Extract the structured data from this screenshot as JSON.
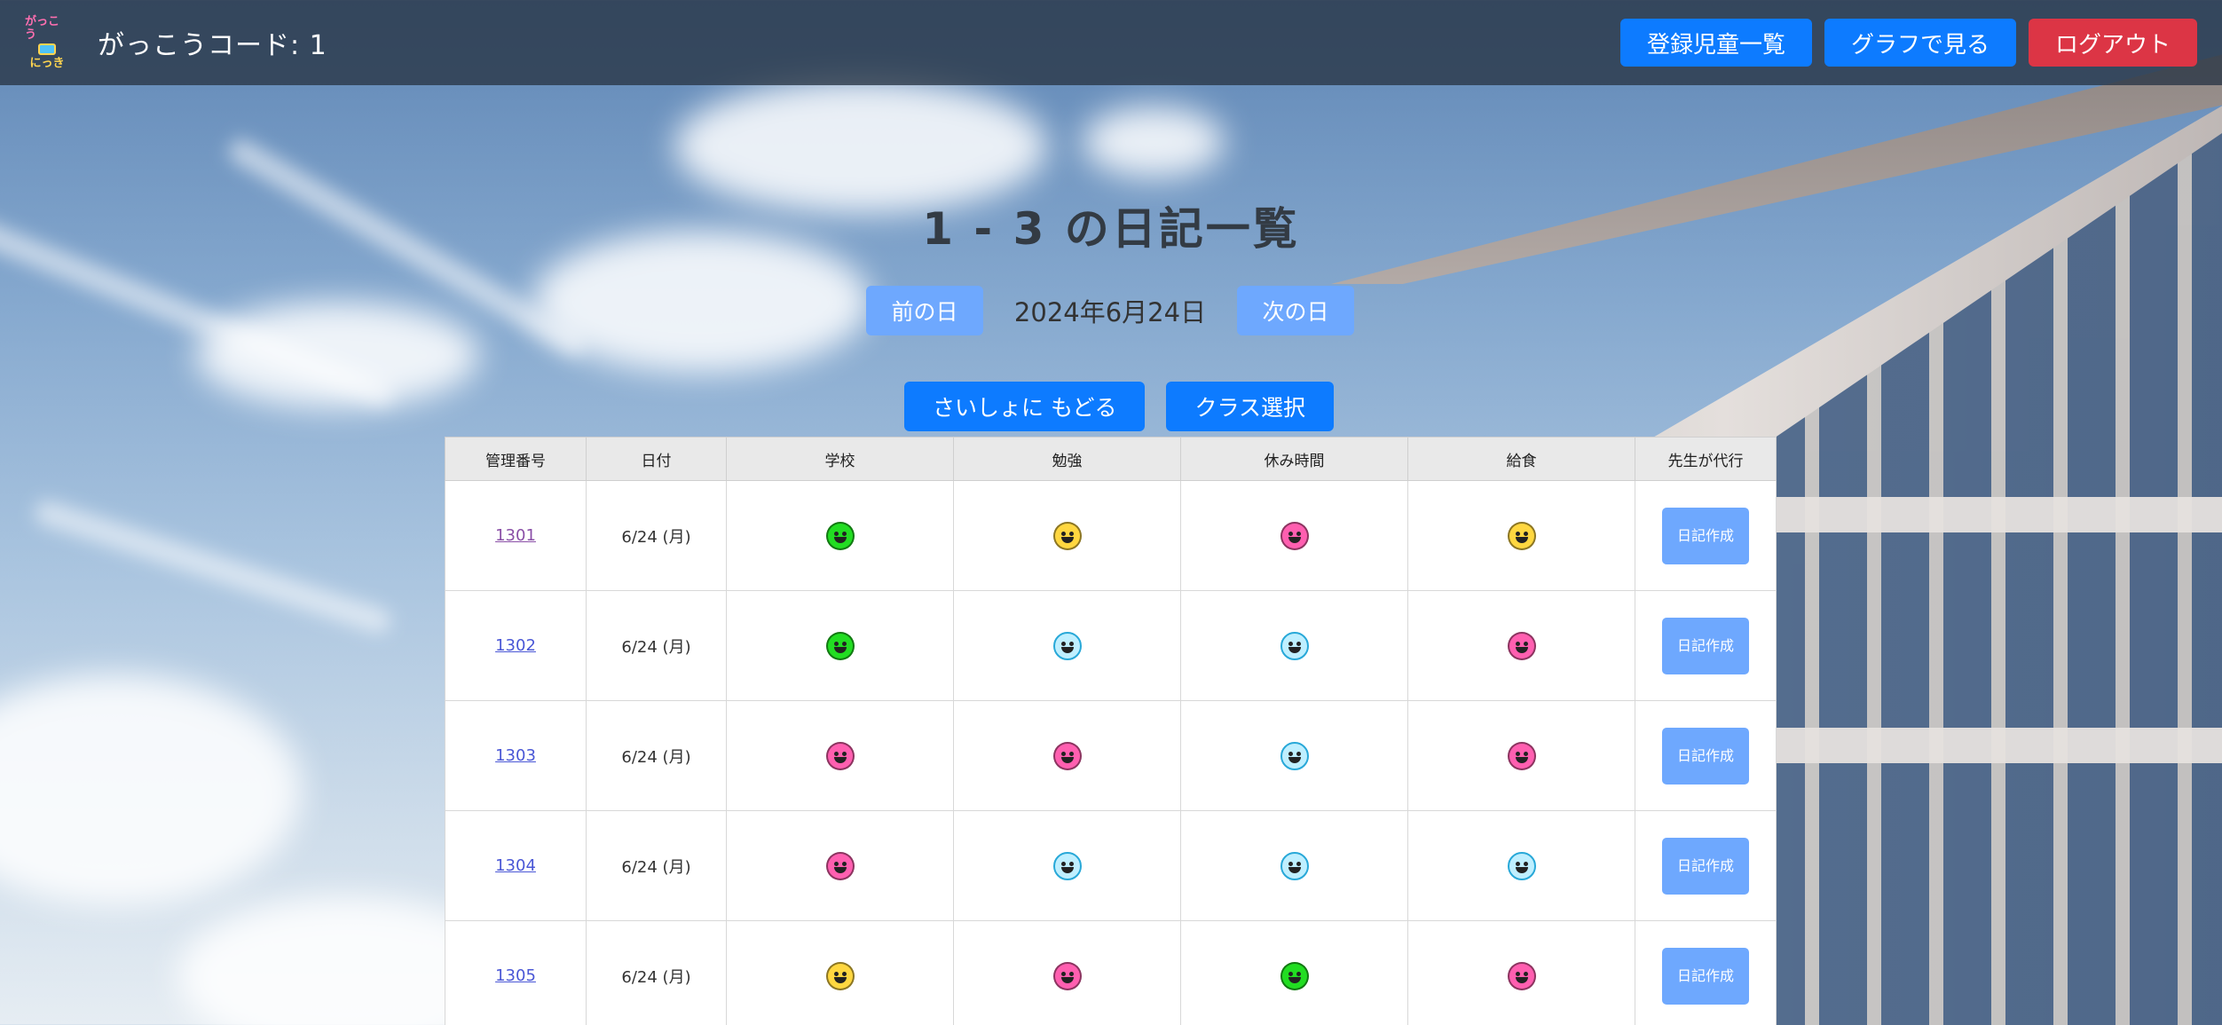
{
  "header": {
    "logo_text_top": "がっこう",
    "logo_text_bottom": "にっき",
    "school_code": "がっこうコード: 1",
    "nav": {
      "students_list": "登録児童一覧",
      "graph": "グラフで見る",
      "logout": "ログアウト"
    }
  },
  "main": {
    "title": "1 - 3 の日記一覧",
    "prev_day": "前の日",
    "current_date": "2024年6月24日",
    "next_day": "次の日",
    "back_to_start": "さいしょに もどる",
    "class_select": "クラス選択"
  },
  "table": {
    "headers": [
      "管理番号",
      "日付",
      "学校",
      "勉強",
      "休み時間",
      "給食",
      "先生が代行"
    ],
    "rows": [
      {
        "id": "1301",
        "date": "6/24 (月)",
        "school": "green",
        "study": "yellow",
        "recess": "pink",
        "lunch": "yellow",
        "action": "日記作成"
      },
      {
        "id": "1302",
        "date": "6/24 (月)",
        "school": "green",
        "study": "blue",
        "recess": "blue",
        "lunch": "pink",
        "action": "日記作成"
      },
      {
        "id": "1303",
        "date": "6/24 (月)",
        "school": "pink",
        "study": "pink",
        "recess": "blue",
        "lunch": "pink",
        "action": "日記作成"
      },
      {
        "id": "1304",
        "date": "6/24 (月)",
        "school": "pink",
        "study": "blue",
        "recess": "blue",
        "lunch": "blue",
        "action": "日記作成"
      },
      {
        "id": "1305",
        "date": "6/24 (月)",
        "school": "yellow",
        "study": "pink",
        "recess": "green",
        "lunch": "pink",
        "action": "日記作成"
      }
    ]
  },
  "colors": {
    "primary": "#0d7bff",
    "danger": "#dc3545",
    "light_button": "#6ea8fe",
    "mood_green": "#22dd22",
    "mood_yellow": "#ffd740",
    "mood_pink": "#ff5fb0",
    "mood_blue": "#bfefff"
  }
}
